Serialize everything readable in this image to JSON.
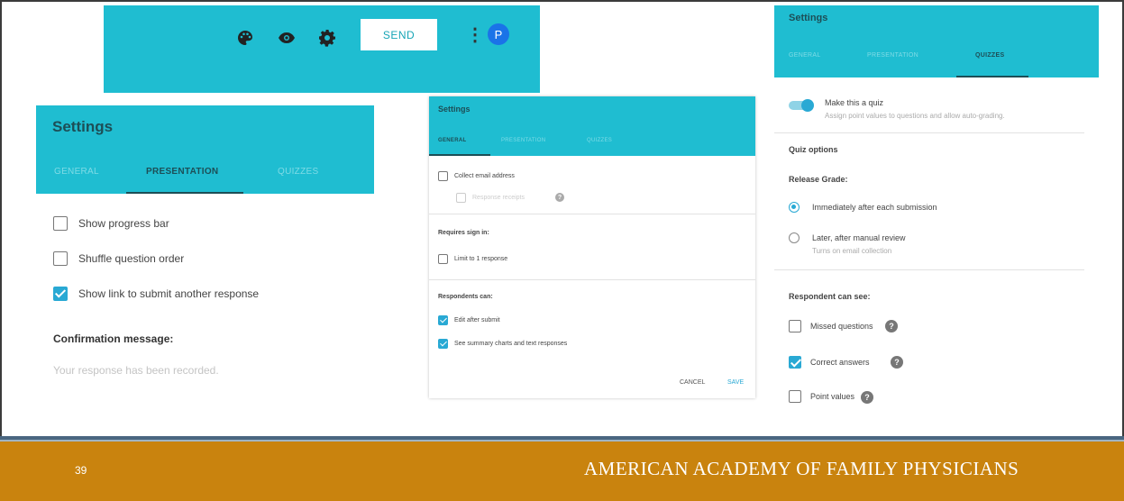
{
  "toolbar": {
    "icons": [
      "palette-icon",
      "eye-icon",
      "gear-icon"
    ],
    "send_label": "SEND",
    "avatar_initial": "P"
  },
  "presentation_panel": {
    "title": "Settings",
    "tabs": [
      "GENERAL",
      "PRESENTATION",
      "QUIZZES"
    ],
    "active_tab": "PRESENTATION",
    "options": [
      {
        "label": "Show progress bar",
        "checked": false
      },
      {
        "label": "Shuffle question order",
        "checked": false
      },
      {
        "label": "Show link to submit another response",
        "checked": true
      }
    ],
    "confirmation_label": "Confirmation message:",
    "confirmation_placeholder": "Your response has been recorded."
  },
  "general_panel": {
    "title": "Settings",
    "tabs": [
      "GENERAL",
      "PRESENTATION",
      "QUIZZES"
    ],
    "active_tab": "GENERAL",
    "collect_email": "Collect email address",
    "response_receipts": "Response receipts",
    "requires_signin": "Requires sign in:",
    "limit_response": "Limit to 1 response",
    "respondents_can": "Respondents can:",
    "edit_after_submit": "Edit after submit",
    "see_summary": "See summary charts and text responses",
    "cancel_label": "CANCEL",
    "save_label": "SAVE"
  },
  "quizzes_panel": {
    "title": "Settings",
    "tabs": [
      "GENERAL",
      "PRESENTATION",
      "QUIZZES"
    ],
    "active_tab": "QUIZZES",
    "make_quiz": "Make this a quiz",
    "make_quiz_desc": "Assign point values to questions and allow auto-grading.",
    "quiz_options": "Quiz options",
    "release_grade": "Release Grade:",
    "release_immediate": "Immediately after each submission",
    "release_later": "Later, after manual review",
    "release_later_desc": "Turns on email collection",
    "respondent_can_see": "Respondent can see:",
    "missed_questions": "Missed questions",
    "correct_answers": "Correct answers",
    "point_values": "Point values"
  },
  "footer": {
    "page_number": "39",
    "organization": "AMERICAN ACADEMY OF FAMILY PHYSICIANS"
  },
  "colors": {
    "header_teal": "#1fbdd1",
    "checkbox_blue": "#29a9d4",
    "footer_orange": "#c9830e"
  }
}
